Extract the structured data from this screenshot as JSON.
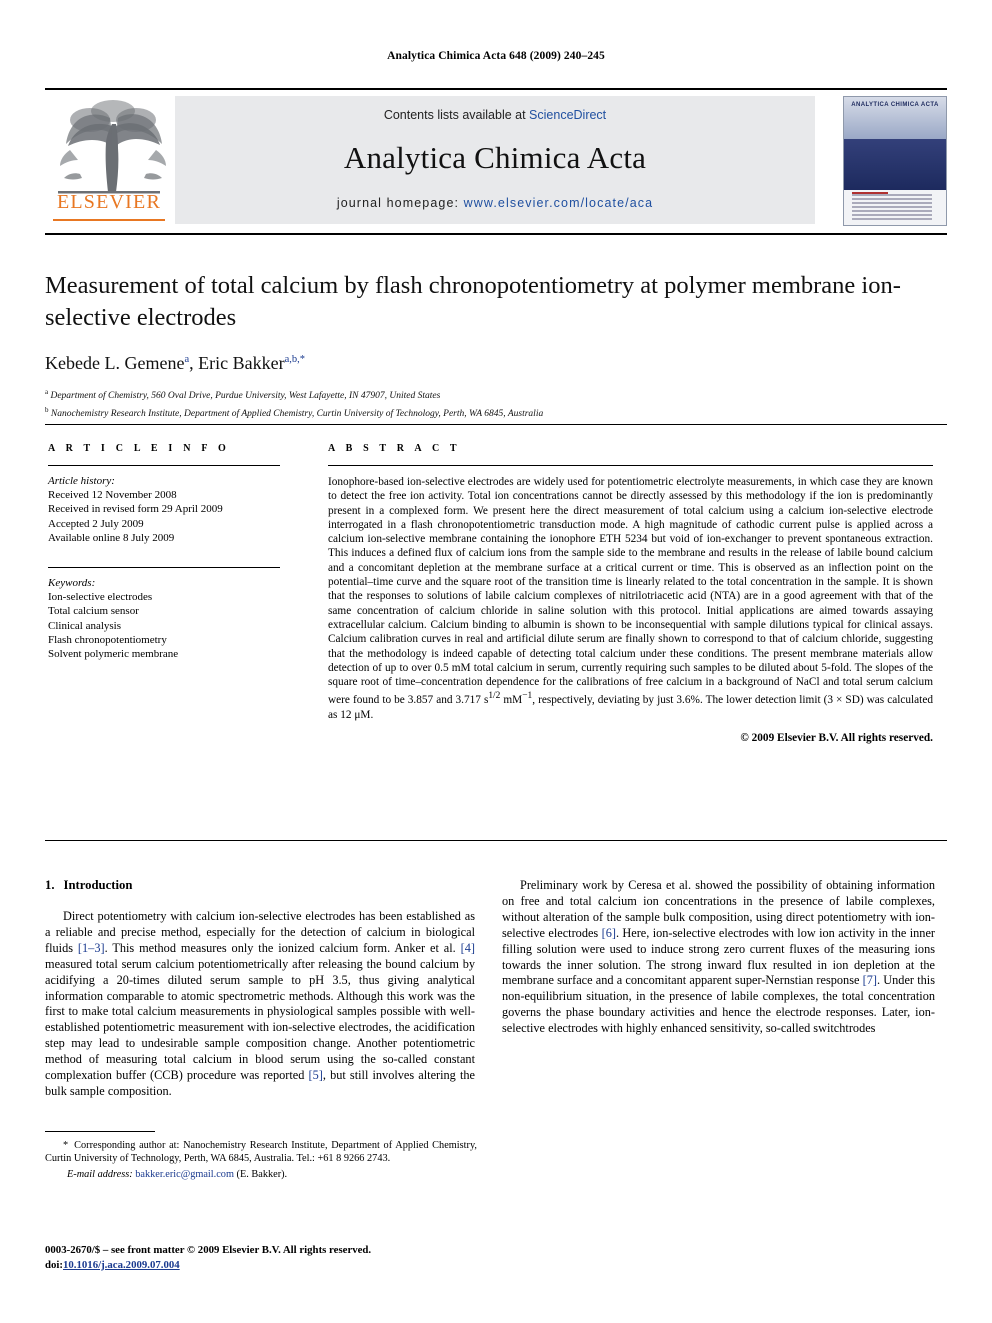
{
  "running_head": "Analytica Chimica Acta 648 (2009) 240–245",
  "masthead": {
    "publisher_logo_text": "ELSEVIER",
    "contents_prefix": "Contents lists available at ",
    "contents_link": "ScienceDirect",
    "journal_title": "Analytica Chimica Acta",
    "homepage_label": "journal homepage: ",
    "homepage_url": "www.elsevier.com/locate/aca",
    "cover_title": "ANALYTICA CHIMICA ACTA"
  },
  "article": {
    "title": "Measurement of total calcium by flash chronopotentiometry at polymer membrane ion-selective electrodes",
    "authors_html": "Kebede L. Gemene<sup>a</sup>, Eric Bakker<sup>a,b,</sup><sup>*</sup>",
    "affiliation_a": "Department of Chemistry, 560 Oval Drive, Purdue University, West Lafayette, IN 47907, United States",
    "affiliation_b": "Nanochemistry Research Institute, Department of Applied Chemistry, Curtin University of Technology, Perth, WA 6845, Australia"
  },
  "info": {
    "heading": "A R T I C L E   I N F O",
    "history_label": "Article history:",
    "history": [
      "Received 12 November 2008",
      "Received in revised form 29 April 2009",
      "Accepted 2 July 2009",
      "Available online 8 July 2009"
    ],
    "keywords_label": "Keywords:",
    "keywords": [
      "Ion-selective electrodes",
      "Total calcium sensor",
      "Clinical analysis",
      "Flash chronopotentiometry",
      "Solvent polymeric membrane"
    ]
  },
  "abstract": {
    "heading": "A B S T R A C T",
    "text": "Ionophore-based ion-selective electrodes are widely used for potentiometric electrolyte measurements, in which case they are known to detect the free ion activity. Total ion concentrations cannot be directly assessed by this methodology if the ion is predominantly present in a complexed form. We present here the direct measurement of total calcium using a calcium ion-selective electrode interrogated in a flash chronopotentiometric transduction mode. A high magnitude of cathodic current pulse is applied across a calcium ion-selective membrane containing the ionophore ETH 5234 but void of ion-exchanger to prevent spontaneous extraction. This induces a defined flux of calcium ions from the sample side to the membrane and results in the release of labile bound calcium and a concomitant depletion at the membrane surface at a critical current or time. This is observed as an inflection point on the potential–time curve and the square root of the transition time is linearly related to the total concentration in the sample. It is shown that the responses to solutions of labile calcium complexes of nitrilotriacetic acid (NTA) are in a good agreement with that of the same concentration of calcium chloride in saline solution with this protocol. Initial applications are aimed towards assaying extracellular calcium. Calcium binding to albumin is shown to be inconsequential with sample dilutions typical for clinical assays. Calcium calibration curves in real and artificial dilute serum are finally shown to correspond to that of calcium chloride, suggesting that the methodology is indeed capable of detecting total calcium under these conditions. The present membrane materials allow detection of up to over 0.5 mM total calcium in serum, currently requiring such samples to be diluted about 5-fold. The slopes of the square root of time–concentration dependence for the calibrations of free calcium in a background of NaCl and total serum calcium were found to be 3.857 and 3.717 s",
    "text_tail": " mM",
    "text_tail2": ", respectively, deviating by just 3.6%. The lower detection limit (3 × SD) was calculated as 12 μM.",
    "sup1": "1/2",
    "sup2": "−1",
    "copyright": "© 2009 Elsevier B.V. All rights reserved."
  },
  "intro": {
    "number": "1.",
    "heading": "Introduction",
    "p1_a": "Direct potentiometry with calcium ion-selective electrodes has been established as a reliable and precise method, especially for the detection of calcium in biological fluids ",
    "p1_ref1": "[1–3]",
    "p1_b": ". This method measures only the ionized calcium form. Anker et al. ",
    "p1_ref2": "[4]",
    "p1_c": " measured total serum calcium potentiometrically after releasing the bound calcium by acidifying a 20-times diluted serum sample to pH 3.5, thus giving analytical information comparable to atomic spectrometric methods. Although this work was the first to make total calcium measurements in physiological samples possible with well-established potentiometric measurement with ion-selective electrodes, the acidification step may lead to undesirable sample composition change. Another potentiometric method of measuring total calcium in blood serum using the so-called constant complexation buffer (CCB) procedure was reported ",
    "p1_ref3": "[5]",
    "p1_d": ", but still involves altering the bulk sample composition.",
    "p2_a": "Preliminary work by Ceresa et al. showed the possibility of obtaining information on free and total calcium ion concentrations in the presence of labile complexes, without alteration of the sample bulk composition, using direct potentiometry with ion-selective electrodes ",
    "p2_ref1": "[6]",
    "p2_b": ". Here, ion-selective electrodes with low ion activity in the inner filling solution were used to induce strong zero current fluxes of the measuring ions towards the inner solution. The strong inward flux resulted in ion depletion at the membrane surface and a concomitant apparent super-Nernstian response ",
    "p2_ref2": "[7]",
    "p2_c": ". Under this non-equilibrium situation, in the presence of labile complexes, the total concentration governs the phase boundary activities and hence the electrode responses. Later, ion-selective electrodes with highly enhanced sensitivity, so-called switchtrodes"
  },
  "footnotes": {
    "corresponding": "Corresponding author at: Nanochemistry Research Institute, Department of Applied Chemistry, Curtin University of Technology, Perth, WA 6845, Australia. Tel.: +61 8 9266 2743.",
    "star": "*",
    "email_label": "E-mail address:",
    "email": "bakker.eric@gmail.com",
    "email_owner": "(E. Bakker).",
    "issn_line": "0003-2670/$ – see front matter © 2009 Elsevier B.V. All rights reserved.",
    "doi_label": "doi:",
    "doi": "10.1016/j.aca.2009.07.004"
  },
  "colors": {
    "link": "#1a3a8f",
    "elsevier_orange": "#e87722",
    "banner_bg": "#e8e9eb",
    "sciencedirect_blue": "#2050a0"
  }
}
